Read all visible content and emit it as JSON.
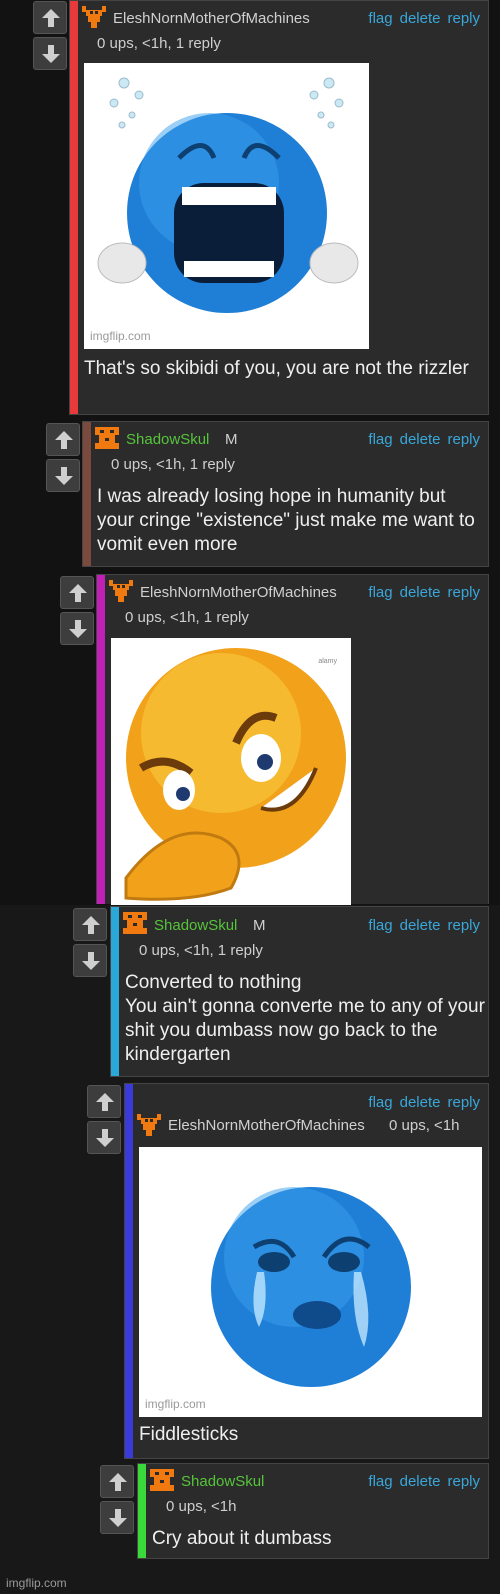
{
  "comments": [
    {
      "user": "EleshNornMotherOfMachines",
      "meta": "0 ups, <1h, 1 reply",
      "actions": [
        "flag",
        "delete",
        "reply"
      ],
      "text": "That's so skibidi of you, you are not the rizzler",
      "image_watermark": "imgflip.com",
      "bar_color": "#e83a3a"
    },
    {
      "user": "ShadowSkul",
      "user_mark": "M",
      "meta": "0 ups, <1h, 1 reply",
      "actions": [
        "flag",
        "delete",
        "reply"
      ],
      "text": "I was already losing hope in humanity but your cringe \"existence\" just make me want to vomit even more",
      "bar_color": "#7b4a3e"
    },
    {
      "user": "EleshNornMotherOfMachines",
      "meta": "0 ups, <1h, 1 reply",
      "actions": [
        "flag",
        "delete",
        "reply"
      ],
      "image_watermark": "alamy",
      "bar_color": "#c21fb6"
    },
    {
      "user": "ShadowSkul",
      "user_mark": "M",
      "meta": "0 ups, <1h, 1 reply",
      "actions": [
        "flag",
        "delete",
        "reply"
      ],
      "text": "Converted to nothing\nYou ain't gonna converte me to any of your shit you dumbass now go back to the kindergarten",
      "bar_color": "#2aa8d8"
    },
    {
      "user": "EleshNornMotherOfMachines",
      "meta": "0 ups, <1h",
      "actions": [
        "flag",
        "delete",
        "reply"
      ],
      "text": "Fiddlesticks",
      "image_watermark": "imgflip.com",
      "bar_color": "#3a3ad8"
    },
    {
      "user": "ShadowSkul",
      "meta": "0 ups, <1h",
      "actions": [
        "flag",
        "delete",
        "reply"
      ],
      "text": "Cry about it dumbass",
      "bar_color": "#3ad83a"
    }
  ],
  "footer": {
    "watermark": "imgflip.com"
  },
  "colors": {
    "background": "#161616",
    "panel": "#2b2b2b",
    "link": "#39a7d9",
    "username_green": "#56c43a",
    "avatar_orange": "#f07a10"
  },
  "icons": {
    "vote_up": "arrow-up-icon",
    "vote_down": "arrow-down-icon",
    "avatar": "pixel-avatar-icon"
  }
}
